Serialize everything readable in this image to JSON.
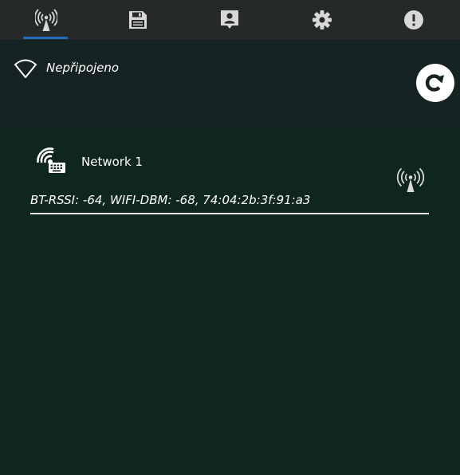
{
  "tabs": [
    {
      "id": "wifi",
      "icon": "wifi-antenna-icon",
      "active": true
    },
    {
      "id": "save",
      "icon": "floppy-disk-icon",
      "active": false
    },
    {
      "id": "contact",
      "icon": "contact-card-icon",
      "active": false
    },
    {
      "id": "settings",
      "icon": "gear-icon",
      "active": false
    },
    {
      "id": "info",
      "icon": "exclamation-circle-icon",
      "active": false
    }
  ],
  "status": {
    "icon": "wifi-outline-icon",
    "text": "Nepřipojeno",
    "refresh_icon": "refresh-icon"
  },
  "networks": [
    {
      "name": "Network 1",
      "icon": "wifi-keyboard-icon",
      "signal_icon": "wifi-antenna-icon",
      "details": "BT-RSSI: -64, WIFI-DBM: -68, 74:04:2b:3f:91:a3"
    }
  ],
  "colors": {
    "background": "#0f2620",
    "tabbar": "#252a29",
    "status_area": "#152422",
    "accent": "#1e6fc2",
    "icon": "#d8d8d8",
    "text": "#ffffff"
  }
}
